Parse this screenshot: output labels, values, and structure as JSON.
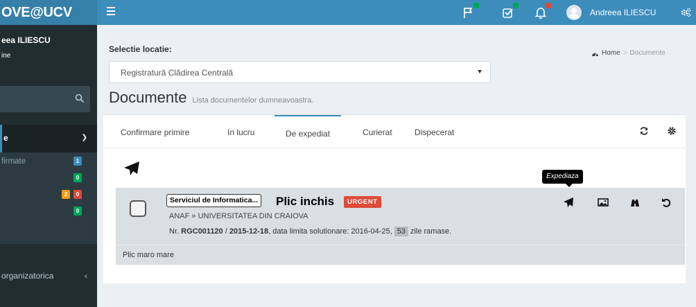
{
  "app": {
    "logo": "OVE@UCV"
  },
  "sidebar": {
    "user_name": "eea ILIESCU",
    "user_status": "ine",
    "menu_head": "e",
    "items": [
      {
        "label": "firmate",
        "badges": [
          {
            "text": "1",
            "color": "#3c8dbc"
          }
        ]
      },
      {
        "label": "",
        "badges": [
          {
            "text": "0",
            "color": "#00a65a"
          }
        ]
      },
      {
        "label": "",
        "badges": [
          {
            "text": "2",
            "color": "#f39c12"
          },
          {
            "text": "0",
            "color": "#dd4b39"
          }
        ]
      },
      {
        "label": "",
        "badges": [
          {
            "text": "0",
            "color": "#00a65a"
          }
        ]
      }
    ],
    "org_item": "organizatorica"
  },
  "navbar": {
    "user_name": "Andreea ILIESCU",
    "badge_colors": [
      "#00a65a",
      "#00a65a",
      "#dd4b39"
    ]
  },
  "location": {
    "label": "Selectie locatie:",
    "selected": "Registratură Clădirea Centrală"
  },
  "breadcrumb": {
    "home": "Home",
    "current": "Documente"
  },
  "page": {
    "title": "Documente",
    "subtitle": "Lista documentelor dumneavoastra."
  },
  "tabs": [
    "Confirmare primire",
    "In lucru",
    "De expediat",
    "Curierat",
    "Dispecerat"
  ],
  "active_tab": "De expediat",
  "tooltip": "Expediaza",
  "document": {
    "department": "Serviciul de Informatica...",
    "title": "Plic inchis",
    "urgency": "URGENT",
    "route": "ANAF » UNIVERSITATEA DIN CRAIOVA",
    "nr_prefix": "Nr. ",
    "nr": "RGC001120",
    "nr_sep": " / ",
    "date": "2015-12-18",
    "deadline_text": ", data limita solutionare: 2016-04-25,",
    "days_left": "53",
    "days_suffix": "zile ramase.",
    "note": "Plic maro mare"
  }
}
